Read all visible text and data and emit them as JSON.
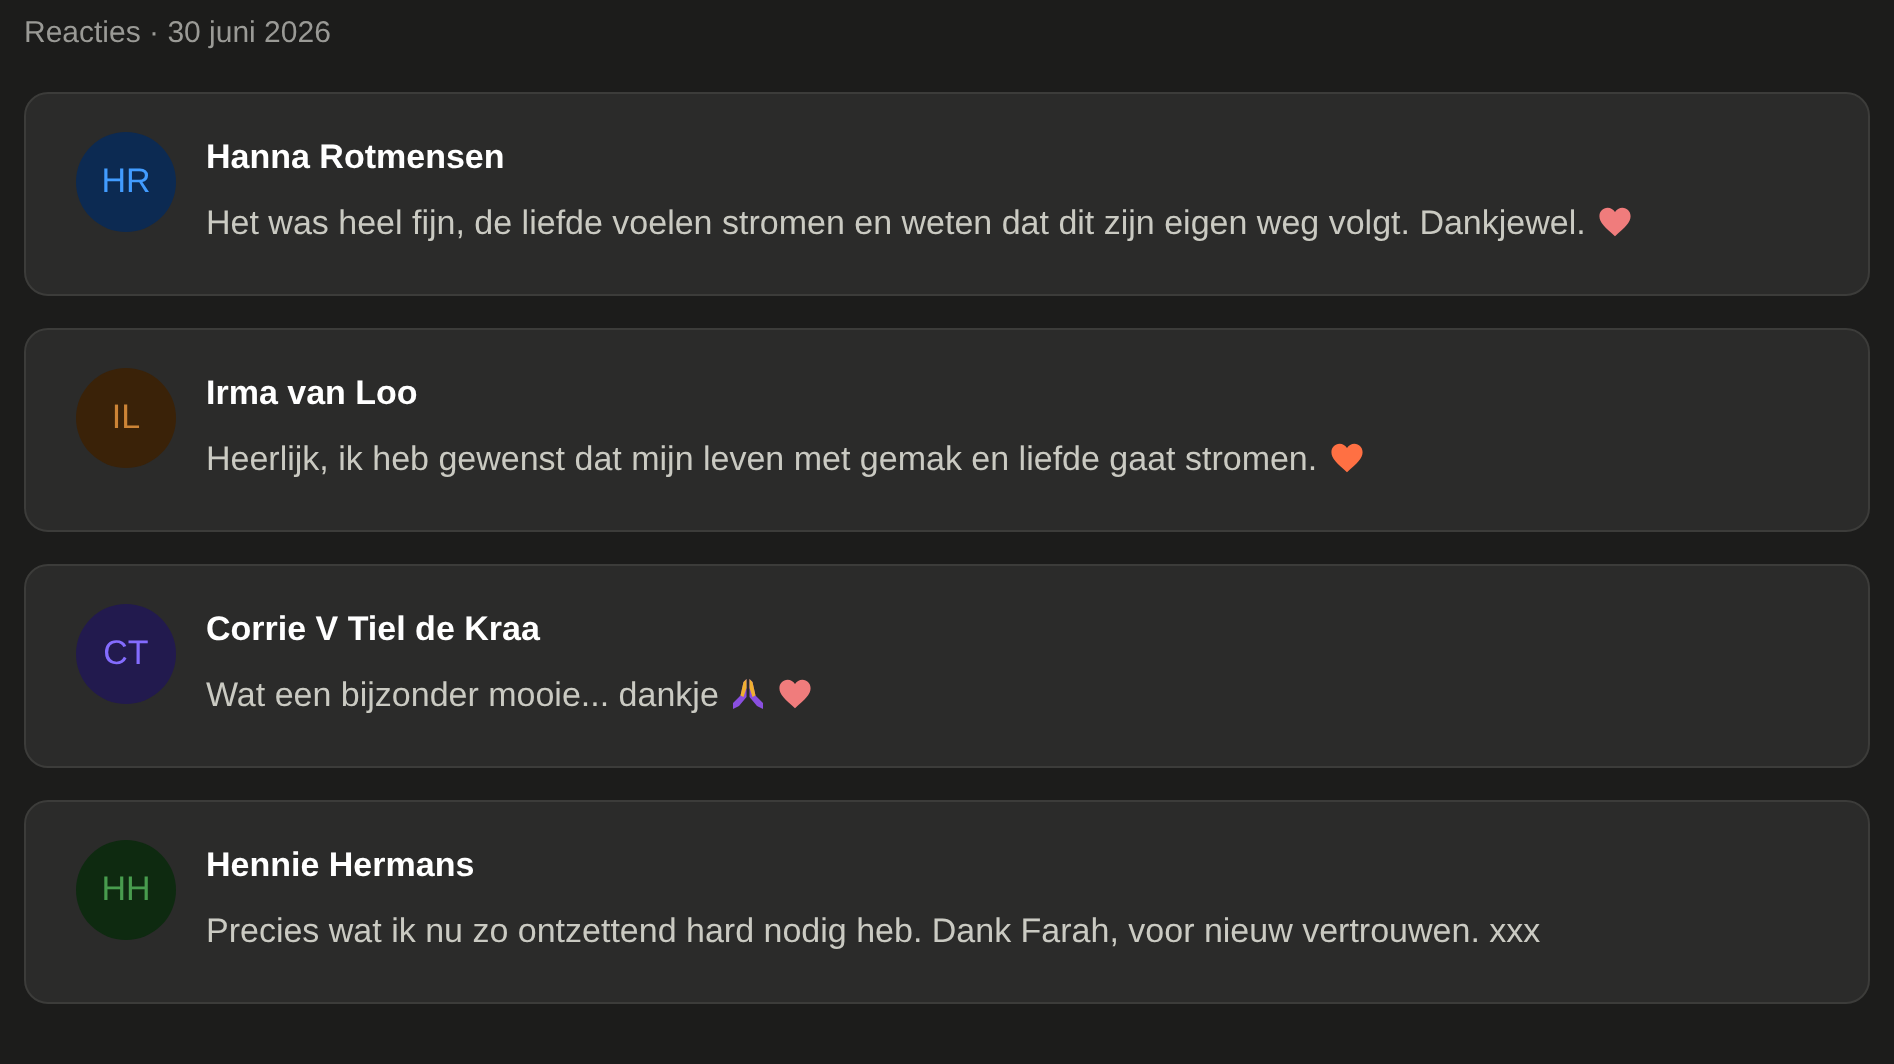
{
  "header": "Reacties · 30 juni 2026",
  "comments": [
    {
      "initials": "HR",
      "color": "#0c2a52",
      "name": "Hanna Rotmensen",
      "text": "Het was heel fijn, de liefde voelen stromen en weten dat dit zijn eigen weg volgt. Dankjewel.",
      "emojis": [
        {
          "kind": "heart",
          "color": "#f07c7c"
        }
      ]
    },
    {
      "initials": "IL",
      "color": "#3a2208",
      "name": "Irma van Loo",
      "text": "Heerlijk, ik heb gewenst dat mijn leven met gemak en liefde gaat stromen.",
      "emojis": [
        {
          "kind": "heart",
          "color": "#ff7043"
        }
      ]
    },
    {
      "initials": "CT",
      "color": "#221a4e",
      "name": "Corrie V Tiel de Kraa",
      "text": "Wat een bijzonder mooie... dankje",
      "emojis": [
        {
          "kind": "hands",
          "color": "#8a4fe0"
        },
        {
          "kind": "heart",
          "color": "#f07c7c"
        }
      ]
    },
    {
      "initials": "HH",
      "color": "#0e2a10",
      "name": "Hennie Hermans",
      "text": "Precies wat ik nu zo ontzettend hard nodig heb. Dank Farah, voor nieuw vertrouwen. xxx"
    }
  ]
}
